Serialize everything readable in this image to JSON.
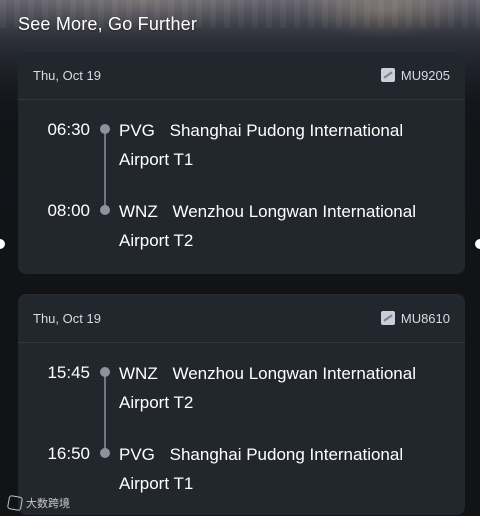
{
  "header": {
    "title": "See More, Go Further"
  },
  "cards": [
    {
      "date": "Thu, Oct 19",
      "flight_number": "MU9205",
      "departure": {
        "time": "06:30",
        "code": "PVG",
        "airport": "Shanghai Pudong International Airport T1"
      },
      "arrival": {
        "time": "08:00",
        "code": "WNZ",
        "airport": "Wenzhou Longwan International Airport T2"
      }
    },
    {
      "date": "Thu, Oct 19",
      "flight_number": "MU8610",
      "departure": {
        "time": "15:45",
        "code": "WNZ",
        "airport": "Wenzhou Longwan International Airport T2"
      },
      "arrival": {
        "time": "16:50",
        "code": "PVG",
        "airport": "Shanghai Pudong International Airport T1"
      }
    }
  ],
  "watermark": {
    "text": "大数跨境"
  },
  "icons": {
    "flight": "airplane-icon",
    "watermark": "logo-icon"
  },
  "colors": {
    "card_bg": "#22262d",
    "timeline": "#6f7782",
    "text": "#ffffff"
  }
}
